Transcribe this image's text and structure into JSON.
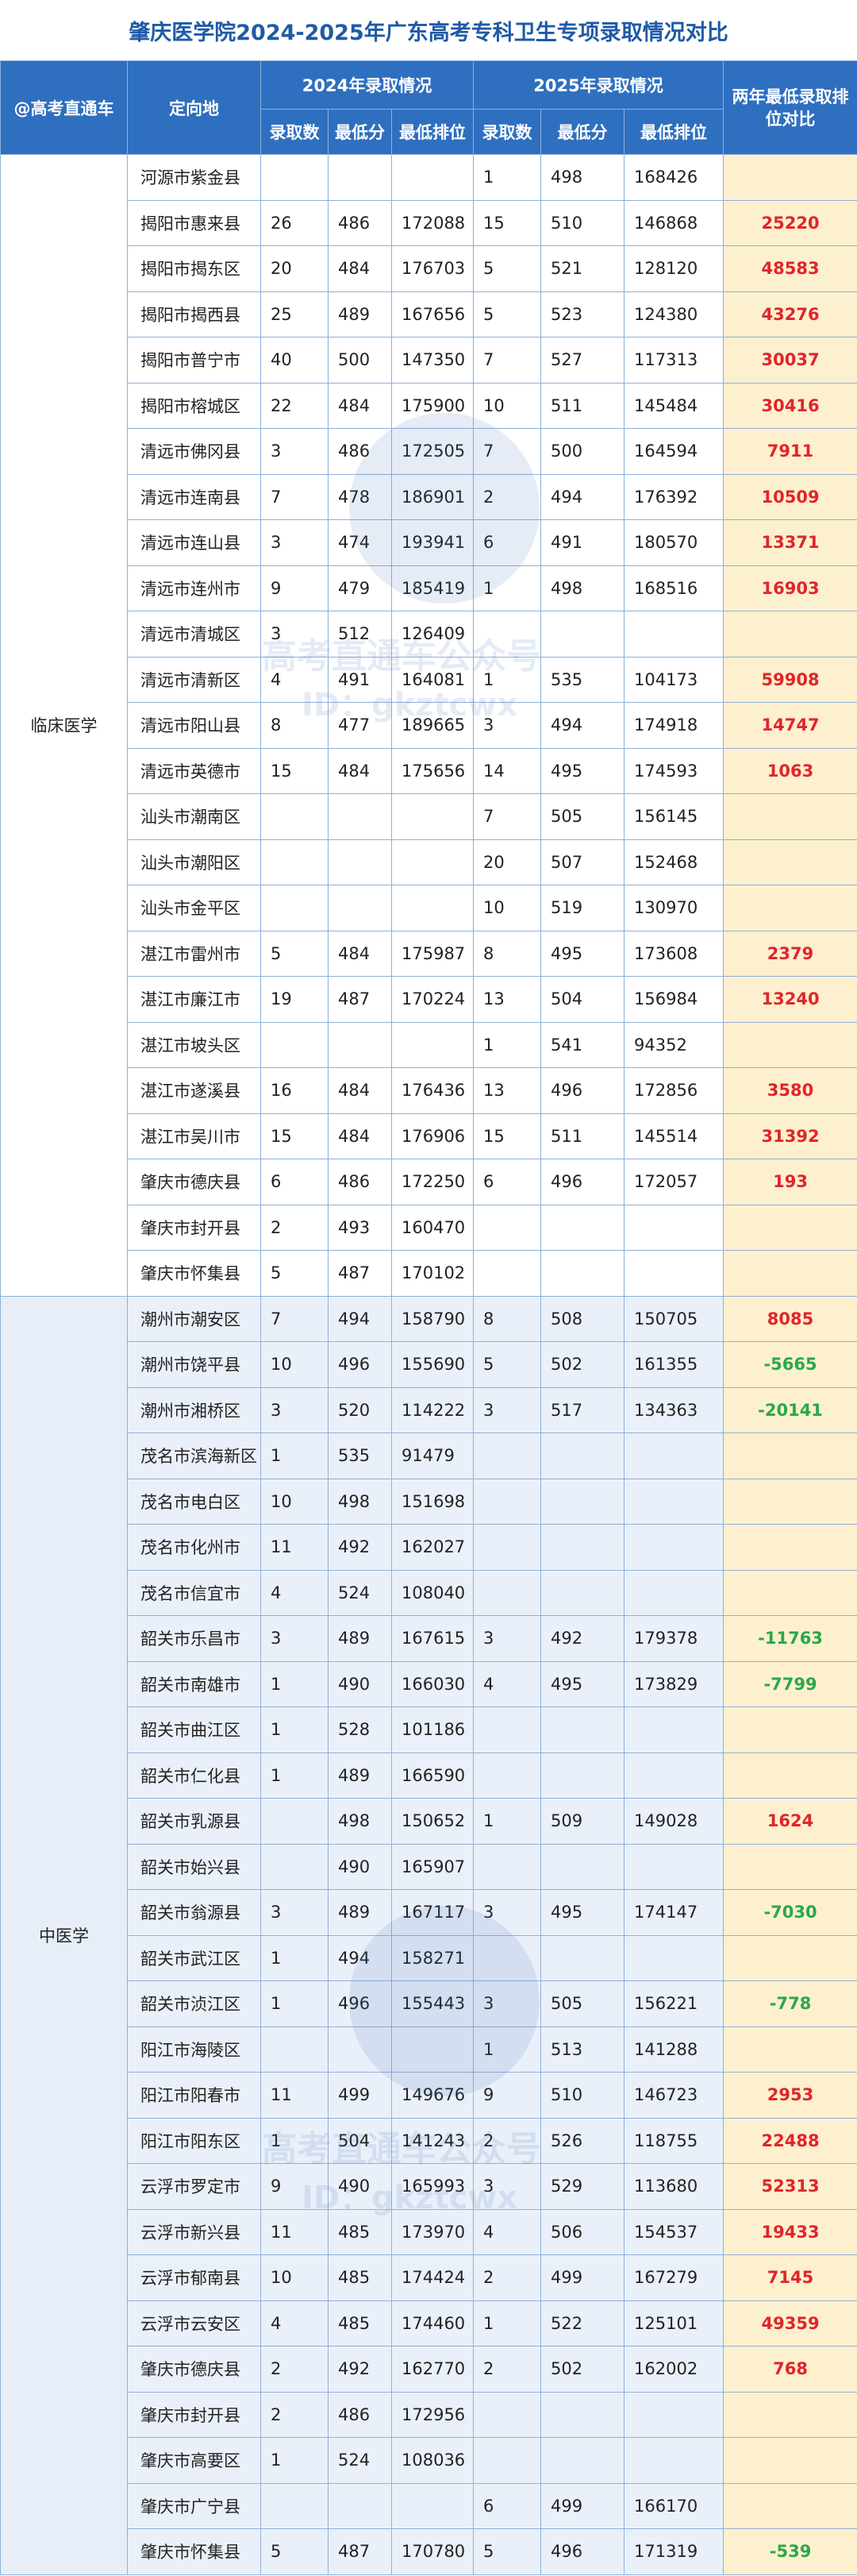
{
  "title": "肇庆医学院2024-2025年广东高考专科卫生专项录取情况对比",
  "header": {
    "source_label": "@高考直通车",
    "region_label": "定向地",
    "year2024": "2024年录取情况",
    "year2025": "2025年录取情况",
    "diff_label": "两年最低录取排位对比",
    "sub_count": "录取数",
    "sub_min_score": "最低分",
    "sub_min_rank": "最低排位"
  },
  "watermark": {
    "line1": "高考直通车公众号",
    "line2": "ID：gkztcwx"
  },
  "groups": [
    {
      "major": "临床医学",
      "rows": [
        {
          "region": "河源市紫金县",
          "c24": "",
          "s24": "",
          "r24": "",
          "c25": "1",
          "s25": "498",
          "r25": "168426",
          "diff": "",
          "sign": ""
        },
        {
          "region": "揭阳市惠来县",
          "c24": "26",
          "s24": "486",
          "r24": "172088",
          "c25": "15",
          "s25": "510",
          "r25": "146868",
          "diff": "25220",
          "sign": "pos"
        },
        {
          "region": "揭阳市揭东区",
          "c24": "20",
          "s24": "484",
          "r24": "176703",
          "c25": "5",
          "s25": "521",
          "r25": "128120",
          "diff": "48583",
          "sign": "pos"
        },
        {
          "region": "揭阳市揭西县",
          "c24": "25",
          "s24": "489",
          "r24": "167656",
          "c25": "5",
          "s25": "523",
          "r25": "124380",
          "diff": "43276",
          "sign": "pos"
        },
        {
          "region": "揭阳市普宁市",
          "c24": "40",
          "s24": "500",
          "r24": "147350",
          "c25": "7",
          "s25": "527",
          "r25": "117313",
          "diff": "30037",
          "sign": "pos"
        },
        {
          "region": "揭阳市榕城区",
          "c24": "22",
          "s24": "484",
          "r24": "175900",
          "c25": "10",
          "s25": "511",
          "r25": "145484",
          "diff": "30416",
          "sign": "pos"
        },
        {
          "region": "清远市佛冈县",
          "c24": "3",
          "s24": "486",
          "r24": "172505",
          "c25": "7",
          "s25": "500",
          "r25": "164594",
          "diff": "7911",
          "sign": "pos"
        },
        {
          "region": "清远市连南县",
          "c24": "7",
          "s24": "478",
          "r24": "186901",
          "c25": "2",
          "s25": "494",
          "r25": "176392",
          "diff": "10509",
          "sign": "pos"
        },
        {
          "region": "清远市连山县",
          "c24": "3",
          "s24": "474",
          "r24": "193941",
          "c25": "6",
          "s25": "491",
          "r25": "180570",
          "diff": "13371",
          "sign": "pos"
        },
        {
          "region": "清远市连州市",
          "c24": "9",
          "s24": "479",
          "r24": "185419",
          "c25": "1",
          "s25": "498",
          "r25": "168516",
          "diff": "16903",
          "sign": "pos"
        },
        {
          "region": "清远市清城区",
          "c24": "3",
          "s24": "512",
          "r24": "126409",
          "c25": "",
          "s25": "",
          "r25": "",
          "diff": "",
          "sign": ""
        },
        {
          "region": "清远市清新区",
          "c24": "4",
          "s24": "491",
          "r24": "164081",
          "c25": "1",
          "s25": "535",
          "r25": "104173",
          "diff": "59908",
          "sign": "pos"
        },
        {
          "region": "清远市阳山县",
          "c24": "8",
          "s24": "477",
          "r24": "189665",
          "c25": "3",
          "s25": "494",
          "r25": "174918",
          "diff": "14747",
          "sign": "pos"
        },
        {
          "region": "清远市英德市",
          "c24": "15",
          "s24": "484",
          "r24": "175656",
          "c25": "14",
          "s25": "495",
          "r25": "174593",
          "diff": "1063",
          "sign": "pos"
        },
        {
          "region": "汕头市潮南区",
          "c24": "",
          "s24": "",
          "r24": "",
          "c25": "7",
          "s25": "505",
          "r25": "156145",
          "diff": "",
          "sign": ""
        },
        {
          "region": "汕头市潮阳区",
          "c24": "",
          "s24": "",
          "r24": "",
          "c25": "20",
          "s25": "507",
          "r25": "152468",
          "diff": "",
          "sign": ""
        },
        {
          "region": "汕头市金平区",
          "c24": "",
          "s24": "",
          "r24": "",
          "c25": "10",
          "s25": "519",
          "r25": "130970",
          "diff": "",
          "sign": ""
        },
        {
          "region": "湛江市雷州市",
          "c24": "5",
          "s24": "484",
          "r24": "175987",
          "c25": "8",
          "s25": "495",
          "r25": "173608",
          "diff": "2379",
          "sign": "pos"
        },
        {
          "region": "湛江市廉江市",
          "c24": "19",
          "s24": "487",
          "r24": "170224",
          "c25": "13",
          "s25": "504",
          "r25": "156984",
          "diff": "13240",
          "sign": "pos"
        },
        {
          "region": "湛江市坡头区",
          "c24": "",
          "s24": "",
          "r24": "",
          "c25": "1",
          "s25": "541",
          "r25": "94352",
          "diff": "",
          "sign": ""
        },
        {
          "region": "湛江市遂溪县",
          "c24": "16",
          "s24": "484",
          "r24": "176436",
          "c25": "13",
          "s25": "496",
          "r25": "172856",
          "diff": "3580",
          "sign": "pos"
        },
        {
          "region": "湛江市吴川市",
          "c24": "15",
          "s24": "484",
          "r24": "176906",
          "c25": "15",
          "s25": "511",
          "r25": "145514",
          "diff": "31392",
          "sign": "pos"
        },
        {
          "region": "肇庆市德庆县",
          "c24": "6",
          "s24": "486",
          "r24": "172250",
          "c25": "6",
          "s25": "496",
          "r25": "172057",
          "diff": "193",
          "sign": "pos"
        },
        {
          "region": "肇庆市封开县",
          "c24": "2",
          "s24": "493",
          "r24": "160470",
          "c25": "",
          "s25": "",
          "r25": "",
          "diff": "",
          "sign": ""
        },
        {
          "region": "肇庆市怀集县",
          "c24": "5",
          "s24": "487",
          "r24": "170102",
          "c25": "",
          "s25": "",
          "r25": "",
          "diff": "",
          "sign": ""
        }
      ]
    },
    {
      "major": "中医学",
      "rows": [
        {
          "region": "潮州市潮安区",
          "c24": "7",
          "s24": "494",
          "r24": "158790",
          "c25": "8",
          "s25": "508",
          "r25": "150705",
          "diff": "8085",
          "sign": "pos"
        },
        {
          "region": "潮州市饶平县",
          "c24": "10",
          "s24": "496",
          "r24": "155690",
          "c25": "5",
          "s25": "502",
          "r25": "161355",
          "diff": "-5665",
          "sign": "neg"
        },
        {
          "region": "潮州市湘桥区",
          "c24": "3",
          "s24": "520",
          "r24": "114222",
          "c25": "3",
          "s25": "517",
          "r25": "134363",
          "diff": "-20141",
          "sign": "neg"
        },
        {
          "region": "茂名市滨海新区",
          "c24": "1",
          "s24": "535",
          "r24": "91479",
          "c25": "",
          "s25": "",
          "r25": "",
          "diff": "",
          "sign": ""
        },
        {
          "region": "茂名市电白区",
          "c24": "10",
          "s24": "498",
          "r24": "151698",
          "c25": "",
          "s25": "",
          "r25": "",
          "diff": "",
          "sign": ""
        },
        {
          "region": "茂名市化州市",
          "c24": "11",
          "s24": "492",
          "r24": "162027",
          "c25": "",
          "s25": "",
          "r25": "",
          "diff": "",
          "sign": ""
        },
        {
          "region": "茂名市信宜市",
          "c24": "4",
          "s24": "524",
          "r24": "108040",
          "c25": "",
          "s25": "",
          "r25": "",
          "diff": "",
          "sign": ""
        },
        {
          "region": "韶关市乐昌市",
          "c24": "3",
          "s24": "489",
          "r24": "167615",
          "c25": "3",
          "s25": "492",
          "r25": "179378",
          "diff": "-11763",
          "sign": "neg"
        },
        {
          "region": "韶关市南雄市",
          "c24": "1",
          "s24": "490",
          "r24": "166030",
          "c25": "4",
          "s25": "495",
          "r25": "173829",
          "diff": "-7799",
          "sign": "neg"
        },
        {
          "region": "韶关市曲江区",
          "c24": "1",
          "s24": "528",
          "r24": "101186",
          "c25": "",
          "s25": "",
          "r25": "",
          "diff": "",
          "sign": ""
        },
        {
          "region": "韶关市仁化县",
          "c24": "1",
          "s24": "489",
          "r24": "166590",
          "c25": "",
          "s25": "",
          "r25": "",
          "diff": "",
          "sign": ""
        },
        {
          "region": "韶关市乳源县",
          "c24": "",
          "s24": "498",
          "r24": "150652",
          "c25": "1",
          "s25": "509",
          "r25": "149028",
          "diff": "1624",
          "sign": "pos"
        },
        {
          "region": "韶关市始兴县",
          "c24": "",
          "s24": "490",
          "r24": "165907",
          "c25": "",
          "s25": "",
          "r25": "",
          "diff": "",
          "sign": ""
        },
        {
          "region": "韶关市翁源县",
          "c24": "3",
          "s24": "489",
          "r24": "167117",
          "c25": "3",
          "s25": "495",
          "r25": "174147",
          "diff": "-7030",
          "sign": "neg"
        },
        {
          "region": "韶关市武江区",
          "c24": "1",
          "s24": "494",
          "r24": "158271",
          "c25": "",
          "s25": "",
          "r25": "",
          "diff": "",
          "sign": ""
        },
        {
          "region": "韶关市浈江区",
          "c24": "1",
          "s24": "496",
          "r24": "155443",
          "c25": "3",
          "s25": "505",
          "r25": "156221",
          "diff": "-778",
          "sign": "neg"
        },
        {
          "region": "阳江市海陵区",
          "c24": "",
          "s24": "",
          "r24": "",
          "c25": "1",
          "s25": "513",
          "r25": "141288",
          "diff": "",
          "sign": ""
        },
        {
          "region": "阳江市阳春市",
          "c24": "11",
          "s24": "499",
          "r24": "149676",
          "c25": "9",
          "s25": "510",
          "r25": "146723",
          "diff": "2953",
          "sign": "pos"
        },
        {
          "region": "阳江市阳东区",
          "c24": "1",
          "s24": "504",
          "r24": "141243",
          "c25": "2",
          "s25": "526",
          "r25": "118755",
          "diff": "22488",
          "sign": "pos"
        },
        {
          "region": "云浮市罗定市",
          "c24": "9",
          "s24": "490",
          "r24": "165993",
          "c25": "3",
          "s25": "529",
          "r25": "113680",
          "diff": "52313",
          "sign": "pos"
        },
        {
          "region": "云浮市新兴县",
          "c24": "11",
          "s24": "485",
          "r24": "173970",
          "c25": "4",
          "s25": "506",
          "r25": "154537",
          "diff": "19433",
          "sign": "pos"
        },
        {
          "region": "云浮市郁南县",
          "c24": "10",
          "s24": "485",
          "r24": "174424",
          "c25": "2",
          "s25": "499",
          "r25": "167279",
          "diff": "7145",
          "sign": "pos"
        },
        {
          "region": "云浮市云安区",
          "c24": "4",
          "s24": "485",
          "r24": "174460",
          "c25": "1",
          "s25": "522",
          "r25": "125101",
          "diff": "49359",
          "sign": "pos"
        },
        {
          "region": "肇庆市德庆县",
          "c24": "2",
          "s24": "492",
          "r24": "162770",
          "c25": "2",
          "s25": "502",
          "r25": "162002",
          "diff": "768",
          "sign": "pos"
        },
        {
          "region": "肇庆市封开县",
          "c24": "2",
          "s24": "486",
          "r24": "172956",
          "c25": "",
          "s25": "",
          "r25": "",
          "diff": "",
          "sign": ""
        },
        {
          "region": "肇庆市高要区",
          "c24": "1",
          "s24": "524",
          "r24": "108036",
          "c25": "",
          "s25": "",
          "r25": "",
          "diff": "",
          "sign": ""
        },
        {
          "region": "肇庆市广宁县",
          "c24": "",
          "s24": "",
          "r24": "",
          "c25": "6",
          "s25": "499",
          "r25": "166170",
          "diff": "",
          "sign": ""
        },
        {
          "region": "肇庆市怀集县",
          "c24": "5",
          "s24": "487",
          "r24": "170780",
          "c25": "5",
          "s25": "496",
          "r25": "171319",
          "diff": "-539",
          "sign": "neg"
        }
      ]
    }
  ]
}
